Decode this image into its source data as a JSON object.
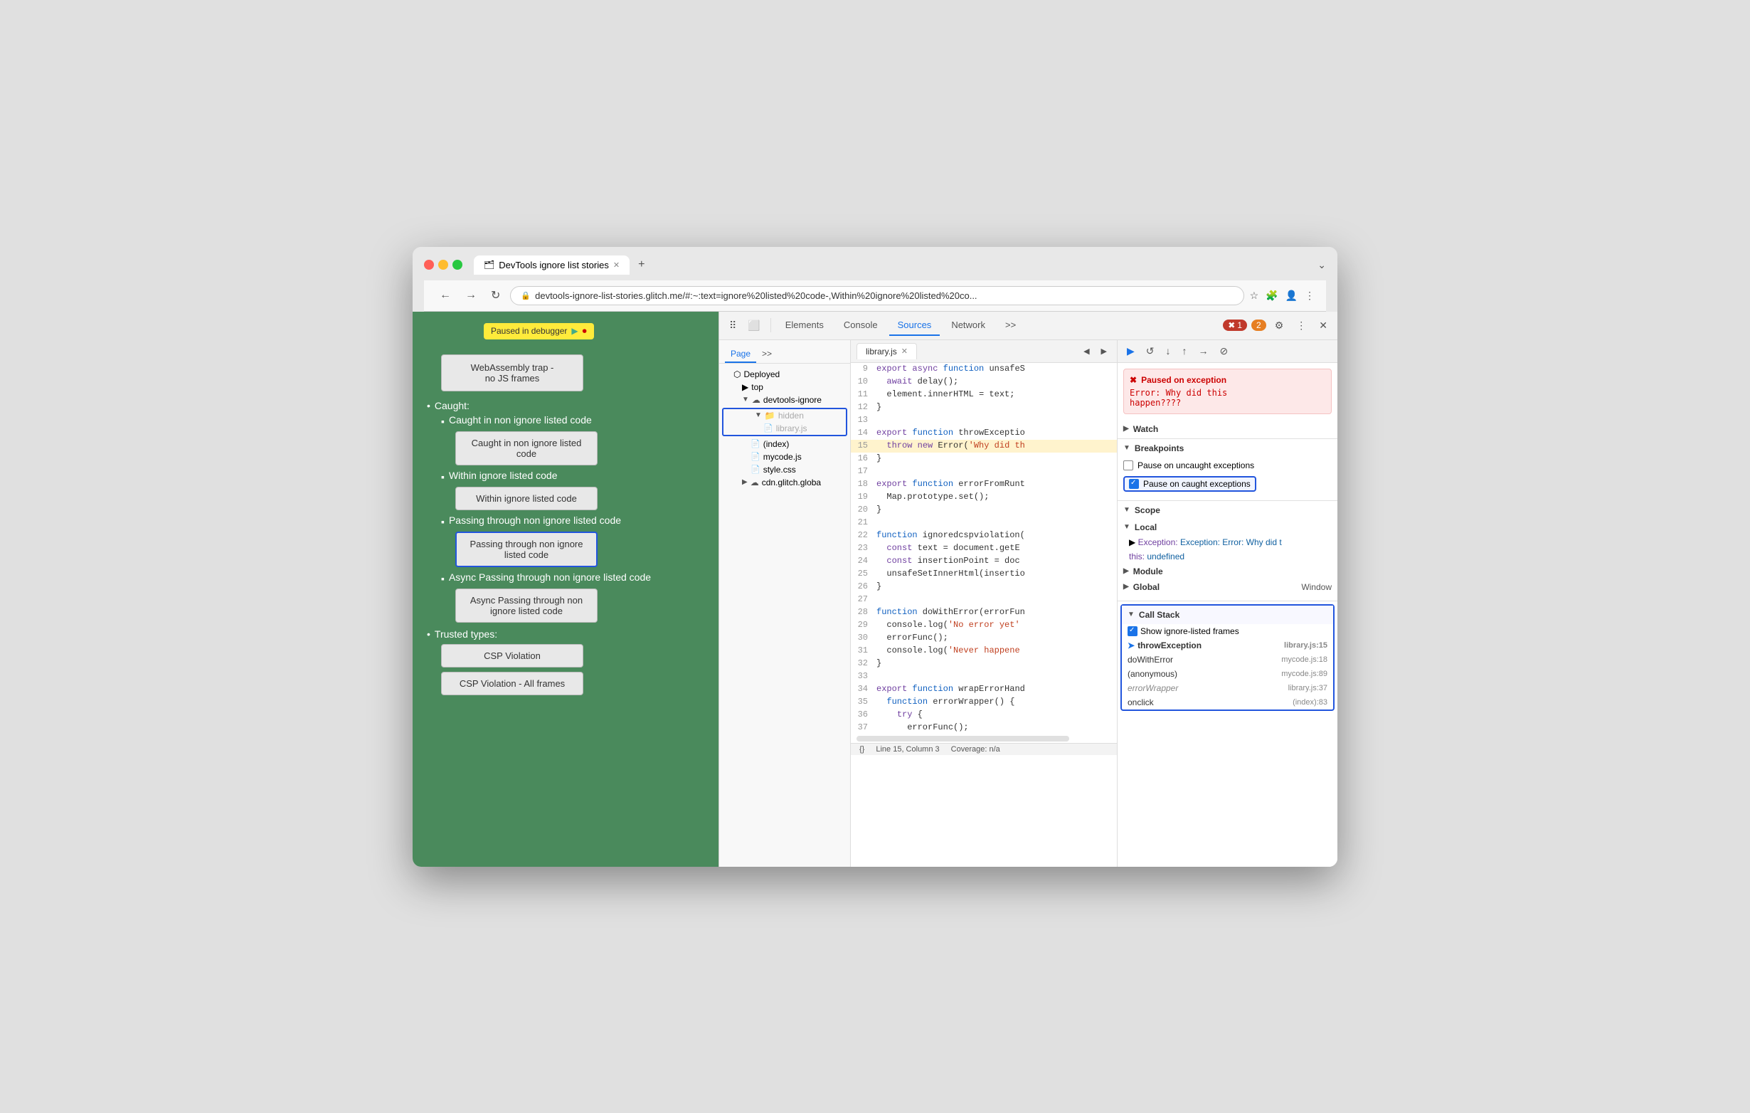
{
  "browser": {
    "tab_title": "DevTools ignore list stories",
    "tab_icon": "🗂",
    "url": "devtools-ignore-list-stories.glitch.me/#:~:text=ignore%20listed%20code-,Within%20ignore%20listed%20co...",
    "new_tab_label": "+",
    "overflow_label": "⌄"
  },
  "page": {
    "paused_badge": "Paused in debugger",
    "webassembly_label": "WebAssembly trap -\nno JS frames",
    "caught_section": "Caught:",
    "items": [
      {
        "label": "Caught in non ignore listed code",
        "button": "Caught in non ignore\nlisted code"
      },
      {
        "label": "Within ignore listed code",
        "button": "Within ignore listed\ncode"
      },
      {
        "label": "Passing through non ignore listed code",
        "button": "Passing through non\nignore listed code",
        "selected": true
      },
      {
        "label": "Async Passing through non ignore listed code",
        "button": "Async Passing\nthrough non ignore\nlisted code"
      }
    ],
    "trusted_types_label": "Trusted types:",
    "csp_btn1": "CSP Violation",
    "csp_btn2": "CSP Violation - All frames"
  },
  "devtools": {
    "toolbar_icons": [
      "⠿",
      "⬜"
    ],
    "tabs": [
      "Elements",
      "Console",
      "Sources",
      "Network",
      ">>"
    ],
    "active_tab": "Sources",
    "error_count": "1",
    "warn_count": "2",
    "settings_icon": "⚙",
    "more_icon": "⋮",
    "close_icon": "✕"
  },
  "sources": {
    "tabs": [
      "Page",
      ">>"
    ],
    "active_tab": "Page",
    "editor_tab": "library.js",
    "file_tree": {
      "deployed_label": "Deployed",
      "top_label": "top",
      "devtools_folder": "devtools-ignore",
      "hidden_folder": "hidden",
      "library_file": "library.js",
      "index_file": "(index)",
      "mycode_file": "mycode.js",
      "style_file": "style.css",
      "cdn_folder": "cdn.glitch.globa"
    },
    "code_lines": [
      {
        "num": "9",
        "text": "export async function unsafeS",
        "highlight": false
      },
      {
        "num": "10",
        "text": "  await delay();",
        "highlight": false
      },
      {
        "num": "11",
        "text": "  element.innerHTML = text;",
        "highlight": false
      },
      {
        "num": "12",
        "text": "}",
        "highlight": false
      },
      {
        "num": "13",
        "text": "",
        "highlight": false
      },
      {
        "num": "14",
        "text": "export function throwExceptio",
        "highlight": false
      },
      {
        "num": "15",
        "text": "  throw new Error('Why did th",
        "highlight": true
      },
      {
        "num": "16",
        "text": "}",
        "highlight": false
      },
      {
        "num": "17",
        "text": "",
        "highlight": false
      },
      {
        "num": "18",
        "text": "export function errorFromRunt",
        "highlight": false
      },
      {
        "num": "19",
        "text": "  Map.prototype.set();",
        "highlight": false
      },
      {
        "num": "20",
        "text": "}",
        "highlight": false
      },
      {
        "num": "21",
        "text": "",
        "highlight": false
      },
      {
        "num": "22",
        "text": "function ignoredcspviolation(",
        "highlight": false
      },
      {
        "num": "23",
        "text": "  const text = document.getE",
        "highlight": false
      },
      {
        "num": "24",
        "text": "  const insertionPoint = doc",
        "highlight": false
      },
      {
        "num": "25",
        "text": "  unsafeSetInnerHtml(insertio",
        "highlight": false
      },
      {
        "num": "26",
        "text": "}",
        "highlight": false
      },
      {
        "num": "27",
        "text": "",
        "highlight": false
      },
      {
        "num": "28",
        "text": "function doWithError(errorFun",
        "highlight": false
      },
      {
        "num": "29",
        "text": "  console.log('No error yet'",
        "highlight": false
      },
      {
        "num": "30",
        "text": "  errorFunc();",
        "highlight": false
      },
      {
        "num": "31",
        "text": "  console.log('Never happene",
        "highlight": false
      },
      {
        "num": "32",
        "text": "}",
        "highlight": false
      },
      {
        "num": "33",
        "text": "",
        "highlight": false
      },
      {
        "num": "34",
        "text": "export function wrapErrorHand",
        "highlight": false
      },
      {
        "num": "35",
        "text": "  function errorWrapper() {",
        "highlight": false
      },
      {
        "num": "36",
        "text": "    try {",
        "highlight": false
      },
      {
        "num": "37",
        "text": "      errorFunc();",
        "highlight": false
      }
    ],
    "status_bar": {
      "line_col": "Line 15, Column 3",
      "coverage": "Coverage: n/a"
    }
  },
  "debugger": {
    "controls": [
      "▶",
      "↺",
      "↓",
      "↑",
      "→↑",
      "⊘"
    ],
    "exception_banner": {
      "title": "Paused on exception",
      "message": "Error: Why did this\nhappen????"
    },
    "sections": {
      "watch": "Watch",
      "breakpoints": "Breakpoints",
      "scope": "Scope",
      "call_stack": "Call Stack"
    },
    "breakpoints": {
      "uncaught_label": "Pause on uncaught exceptions",
      "caught_label": "Pause on caught exceptions",
      "uncaught_checked": false,
      "caught_checked": true
    },
    "scope": {
      "local_label": "Local",
      "module_label": "Module",
      "global_label": "Global",
      "global_value": "Window",
      "exception_label": "Exception: Error: Why did t",
      "this_label": "this:",
      "this_value": "undefined"
    },
    "call_stack": {
      "show_ignore_label": "Show ignore-listed frames",
      "show_ignore_checked": true,
      "frames": [
        {
          "name": "throwException",
          "location": "library.js:15",
          "active": true,
          "dimmed": false
        },
        {
          "name": "doWithError",
          "location": "mycode.js:18",
          "active": false,
          "dimmed": false
        },
        {
          "name": "(anonymous)",
          "location": "mycode.js:89",
          "active": false,
          "dimmed": false
        },
        {
          "name": "errorWrapper",
          "location": "library.js:37",
          "active": false,
          "dimmed": true
        },
        {
          "name": "onclick",
          "location": "(index):83",
          "active": false,
          "dimmed": false
        }
      ]
    }
  }
}
